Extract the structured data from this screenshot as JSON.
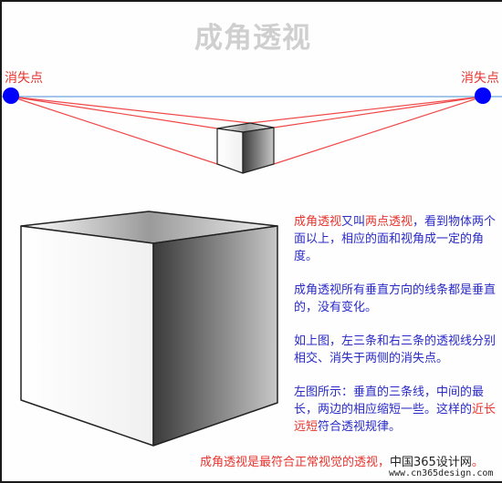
{
  "title": "成角透视",
  "vanishing_point_left": {
    "label": "消失点"
  },
  "vanishing_point_right": {
    "label": "消失点"
  },
  "colors": {
    "title": "#cfcfcf",
    "accent_red": "#e8342f",
    "body_blue": "#2a2ac8",
    "vanishing_point": "#0000ff",
    "horizon": "#6fa3e0"
  },
  "description": {
    "p1": {
      "hl1": "成角透视",
      "t1": "又叫",
      "hl2": "两点透视",
      "t2": "，看到物体两个面以上，相应的面和视角成一定的角度。"
    },
    "p2": "成角透视所有垂直方向的线条都是垂直的，没有变化。",
    "p3": "如上图，左三条和右三条的透视线分别相交、消失于两侧的消失点。",
    "p4": {
      "t1": "左图所示：垂直的三条线，中间的最长，两边的相应缩短一些。这样的",
      "hl": "近长远短",
      "t2": "符合透视规律。"
    }
  },
  "caption": {
    "text": "成角透视是最符合正常视觉的透视，",
    "site": "中国365设计网",
    "end": "。"
  },
  "watermark": "www.cn365design.com"
}
